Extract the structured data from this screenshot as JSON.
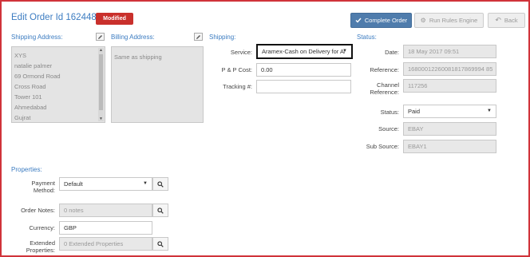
{
  "header": {
    "title": "Edit Order Id 162448",
    "badge": "Modified",
    "complete_order": "Complete Order",
    "run_rules_engine": "Run Rules Engine",
    "back": "Back"
  },
  "shipping_address": {
    "heading": "Shipping Address:",
    "lines": [
      "XYS",
      "natalie palmer",
      "69 Ormond Road",
      "Cross Road",
      "Tower 101",
      "Ahmedabad",
      "Gujrat"
    ]
  },
  "billing_address": {
    "heading": "Billing Address:",
    "text": "Same as shipping"
  },
  "shipping": {
    "heading": "Shipping:",
    "service_label": "Service:",
    "service_value": "Aramex-Cash on Delivery for Ai",
    "pp_cost_label": "P & P Cost:",
    "pp_cost_value": "0.00",
    "tracking_label": "Tracking #:",
    "tracking_value": ""
  },
  "status": {
    "heading": "Status:",
    "date_label": "Date:",
    "date_value": "18 May 2017 09:51",
    "reference_label": "Reference:",
    "reference_value": "16800012260081817869994 85",
    "channel_reference_label_1": "Channel",
    "channel_reference_label_2": "Reference:",
    "channel_reference_value": "117256",
    "status_label": "Status:",
    "status_value": "Paid",
    "source_label": "Source:",
    "source_value": "EBAY",
    "subsource_label": "Sub Source:",
    "subsource_value": "EBAY1"
  },
  "properties": {
    "heading": "Properties:",
    "payment_label_1": "Payment",
    "payment_label_2": "Method:",
    "payment_value": "Default",
    "notes_label": "Order Notes:",
    "notes_value": "0 notes",
    "currency_label": "Currency:",
    "currency_value": "GBP",
    "ext_label_1": "Extended",
    "ext_label_2": "Properties:",
    "ext_value": "0 Extended Properties"
  },
  "colors": {
    "accent": "#3c7cc1",
    "primary_button": "#4f7cac",
    "badge": "#c9302c",
    "border": "#d0333a"
  }
}
